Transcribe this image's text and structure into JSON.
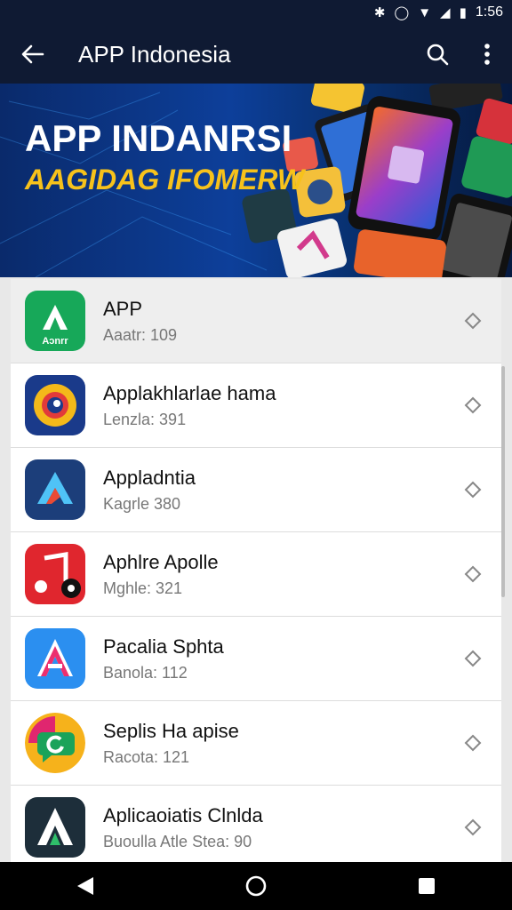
{
  "status": {
    "time": "1:56"
  },
  "app_bar": {
    "title": "APP Indonesia"
  },
  "banner": {
    "title": "APP INDANRSI",
    "subtitle": "AAGIDAG IFOMERW"
  },
  "list": [
    {
      "name": "APP",
      "sub": "Aaatr: 109",
      "icon": "green-a-icon"
    },
    {
      "name": "Applakhlarlae hama",
      "sub": "Lenzla: 391",
      "icon": "chrome-style-icon"
    },
    {
      "name": "Appladntia",
      "sub": "Kagrle 380",
      "icon": "blue-a-icon"
    },
    {
      "name": "Aphlre Apolle",
      "sub": "Mghle: 321",
      "icon": "music-note-icon"
    },
    {
      "name": "Pacalia Sphta",
      "sub": "Banola: 112",
      "icon": "pink-a-icon"
    },
    {
      "name": "Seplis Ha apise",
      "sub": "Racota: 121",
      "icon": "chat-bubble-icon"
    },
    {
      "name": "Aplicaoiatis Clnlda",
      "sub": "Buoulla Atle Stea: 90",
      "icon": "dark-a-icon"
    }
  ],
  "colors": {
    "app_bar": "#0f1a33",
    "accent_yellow": "#f7c21b"
  }
}
